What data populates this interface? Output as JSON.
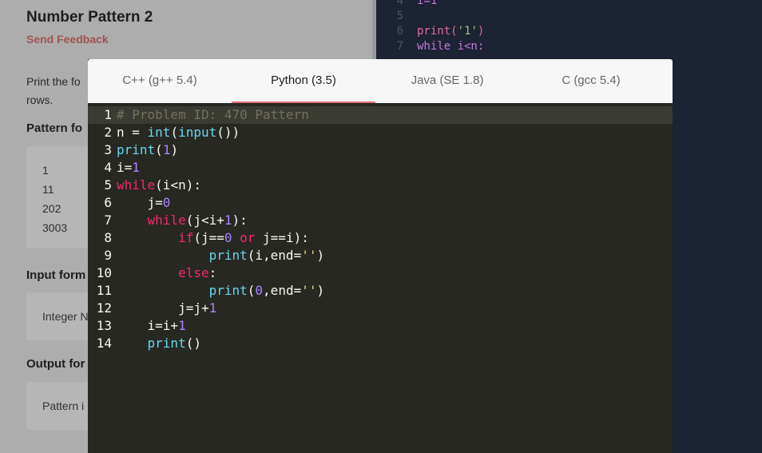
{
  "problem": {
    "title": "Number Pattern 2",
    "feedback_link": "Send Feedback",
    "description_partial": "Print the fo rows.",
    "pattern_heading": "Pattern fo",
    "pattern_lines": [
      "1",
      "11",
      "202",
      "3003"
    ],
    "input_heading": "Input form",
    "input_box": "Integer N",
    "output_heading": "Output for",
    "output_box": "Pattern i"
  },
  "background_editor": {
    "lines": [
      {
        "n": "4",
        "text": "i=1"
      },
      {
        "n": "5",
        "text": ""
      },
      {
        "n": "6",
        "text": "print('1')"
      },
      {
        "n": "7",
        "text": "while i<n:"
      }
    ]
  },
  "modal": {
    "tabs": [
      {
        "label": "C++ (g++ 5.4)",
        "active": false
      },
      {
        "label": "Python (3.5)",
        "active": true
      },
      {
        "label": "Java (SE 1.8)",
        "active": false
      },
      {
        "label": "C (gcc 5.4)",
        "active": false
      }
    ],
    "selected_tab": "Python (3.5)",
    "language": "python",
    "code_lines": [
      {
        "n": "1",
        "text": "# Problem ID: 470 Pattern"
      },
      {
        "n": "2",
        "text": "n = int(input())"
      },
      {
        "n": "3",
        "text": "print(1)"
      },
      {
        "n": "4",
        "text": "i=1"
      },
      {
        "n": "5",
        "text": "while(i<n):"
      },
      {
        "n": "6",
        "text": "    j=0"
      },
      {
        "n": "7",
        "text": "    while(j<i+1):"
      },
      {
        "n": "8",
        "text": "        if(j==0 or j==i):"
      },
      {
        "n": "9",
        "text": "            print(i,end='')"
      },
      {
        "n": "10",
        "text": "        else:"
      },
      {
        "n": "11",
        "text": "            print(0,end='')"
      },
      {
        "n": "12",
        "text": "        j=j+1"
      },
      {
        "n": "13",
        "text": "    i=i+1"
      },
      {
        "n": "14",
        "text": "    print()"
      }
    ],
    "active_line": 1
  },
  "colors": {
    "editor_bg": "#272822",
    "keyword": "#f92672",
    "builtin": "#66d9ef",
    "number": "#ae81ff",
    "string": "#e6db74",
    "comment": "#75715e",
    "tab_underline": "#e57373"
  }
}
